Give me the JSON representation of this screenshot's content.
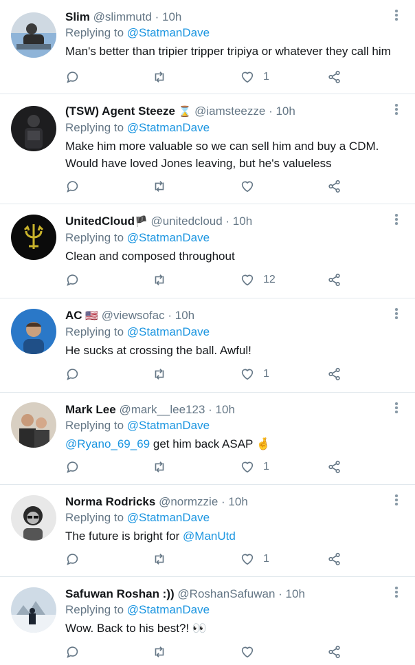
{
  "icons": {
    "reply": "reply-icon",
    "retweet": "retweet-icon",
    "like": "heart-icon",
    "share": "share-icon",
    "more": "more-icon"
  },
  "colors": {
    "link": "#1b95e0",
    "secondary": "#657786",
    "divider": "#e1e8ed"
  },
  "tweets": [
    {
      "name": "Slim",
      "handle": "@slimmutd",
      "time": "· 10h",
      "replying_prefix": "Replying to ",
      "replying_handle": "@StatmanDave",
      "text": "Man's better than tripier tripper tripiya or whatever they call him",
      "likes": "1"
    },
    {
      "name": "(TSW) Agent Steeze",
      "name_emoji": "⌛",
      "handle": "@iamsteezze",
      "time": "· 10h",
      "replying_prefix": "Replying to ",
      "replying_handle": "@StatmanDave",
      "text_line1": "Make him more valuable so we can sell him and buy a CDM.",
      "text_line2": "Would have loved Jones leaving, but he's valueless",
      "likes": ""
    },
    {
      "name": "UnitedCloud",
      "name_emoji": "🏴",
      "handle": "@unitedcloud",
      "time": "· 10h",
      "replying_prefix": "Replying to ",
      "replying_handle": "@StatmanDave",
      "text": "Clean and composed throughout",
      "likes": "12"
    },
    {
      "name": "AC",
      "name_emoji": "🇺🇸",
      "handle": "@viewsofac",
      "time": "· 10h",
      "replying_prefix": "Replying to ",
      "replying_handle": "@StatmanDave",
      "text": "He sucks at crossing the ball. Awful!",
      "likes": "1"
    },
    {
      "name": "Mark Lee",
      "handle": "@mark__lee123",
      "time": "· 10h",
      "replying_prefix": "Replying to ",
      "replying_handle": "@StatmanDave",
      "mention": "@Ryano_69_69",
      "text": " get him back ASAP ",
      "text_emoji": "🤞",
      "likes": "1"
    },
    {
      "name": "Norma Rodricks",
      "handle": "@normzzie",
      "time": "· 10h",
      "replying_prefix": "Replying to ",
      "replying_handle": "@StatmanDave",
      "text": "The future is bright for ",
      "mention": "@ManUtd",
      "likes": "1"
    },
    {
      "name": "Safuwan Roshan :))",
      "handle": "@RoshanSafuwan",
      "time": "· 10h",
      "replying_prefix": "Replying to ",
      "replying_handle": "@StatmanDave",
      "text": "Wow. Back to his best?! ",
      "text_emoji": "👀",
      "likes": ""
    }
  ]
}
